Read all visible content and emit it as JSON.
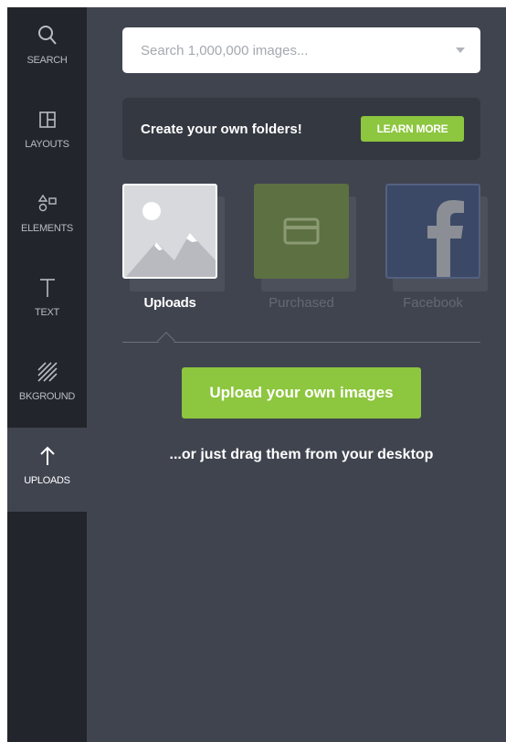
{
  "sidebar": {
    "items": [
      {
        "label": "SEARCH",
        "icon": "search-icon"
      },
      {
        "label": "LAYOUTS",
        "icon": "layout-icon"
      },
      {
        "label": "ELEMENTS",
        "icon": "shapes-icon"
      },
      {
        "label": "TEXT",
        "icon": "text-icon"
      },
      {
        "label": "BKGROUND",
        "icon": "pattern-icon"
      },
      {
        "label": "UPLOADS",
        "icon": "upload-arrow-icon",
        "active": true
      }
    ]
  },
  "search": {
    "placeholder": "Search 1,000,000 images..."
  },
  "folders": {
    "text": "Create your own folders!",
    "button_label": "LEARN MORE"
  },
  "sources": [
    {
      "label": "Uploads",
      "active": true
    },
    {
      "label": "Purchased",
      "active": false
    },
    {
      "label": "Facebook",
      "active": false
    }
  ],
  "upload": {
    "button_label": "Upload your own images",
    "drag_hint": "...or just drag them from your desktop"
  },
  "colors": {
    "accent": "#8dc63f",
    "sidebar_bg": "#22252b",
    "panel_bg": "#40444f"
  }
}
